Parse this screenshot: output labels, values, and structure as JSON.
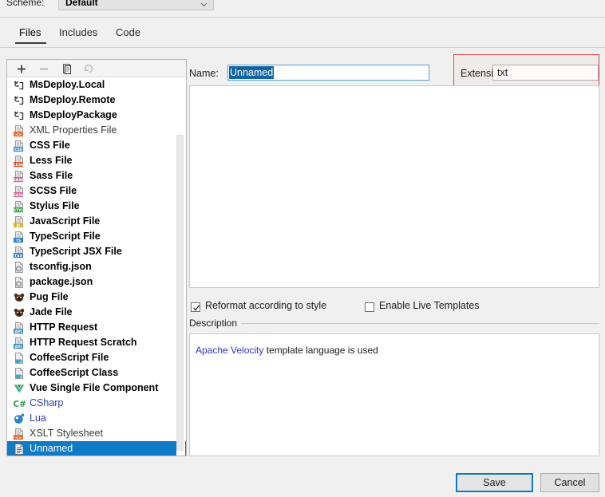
{
  "scheme": {
    "label": "Scheme:",
    "value": "Default",
    "chevron_icon": "chevron-down-icon"
  },
  "tabs": [
    {
      "label": "Files",
      "active": true
    },
    {
      "label": "Includes",
      "active": false
    },
    {
      "label": "Code",
      "active": false
    }
  ],
  "list_toolbar": [
    {
      "name": "add-button",
      "icon": "plus-icon",
      "enabled": true
    },
    {
      "name": "remove-button",
      "icon": "minus-icon",
      "enabled": false
    },
    {
      "name": "copy-button",
      "icon": "copy-icon",
      "enabled": true
    },
    {
      "name": "revert-button",
      "icon": "undo-arrow-icon",
      "enabled": false
    }
  ],
  "file_list": [
    {
      "label": "MsDeploy.Local",
      "icon": "msdeploy-icon",
      "style": "bold"
    },
    {
      "label": "MsDeploy.Remote",
      "icon": "msdeploy-icon",
      "style": "bold"
    },
    {
      "label": "MsDeployPackage",
      "icon": "msdeploy-icon",
      "style": "bold"
    },
    {
      "label": "XML Properties File",
      "icon": "xml-file-icon",
      "style": "norm"
    },
    {
      "label": "CSS File",
      "icon": "css-file-icon",
      "style": "bold"
    },
    {
      "label": "Less File",
      "icon": "less-file-icon",
      "style": "bold"
    },
    {
      "label": "Sass File",
      "icon": "sass-file-icon",
      "style": "bold"
    },
    {
      "label": "SCSS File",
      "icon": "scss-file-icon",
      "style": "bold"
    },
    {
      "label": "Stylus File",
      "icon": "stylus-file-icon",
      "style": "bold"
    },
    {
      "label": "JavaScript File",
      "icon": "javascript-file-icon",
      "style": "bold"
    },
    {
      "label": "TypeScript File",
      "icon": "typescript-file-icon",
      "style": "bold"
    },
    {
      "label": "TypeScript JSX File",
      "icon": "typescript-jsx-file-icon",
      "style": "bold"
    },
    {
      "label": "tsconfig.json",
      "icon": "json-config-icon",
      "style": "bold"
    },
    {
      "label": "package.json",
      "icon": "json-config-icon",
      "style": "bold"
    },
    {
      "label": "Pug File",
      "icon": "pug-file-icon",
      "style": "bold"
    },
    {
      "label": "Jade File",
      "icon": "pug-file-icon",
      "style": "bold"
    },
    {
      "label": "HTTP Request",
      "icon": "http-request-icon",
      "style": "bold"
    },
    {
      "label": "HTTP Request Scratch",
      "icon": "http-request-icon",
      "style": "bold"
    },
    {
      "label": "CoffeeScript File",
      "icon": "coffeescript-file-icon",
      "style": "bold"
    },
    {
      "label": "CoffeeScript Class",
      "icon": "coffeescript-file-icon",
      "style": "bold"
    },
    {
      "label": "Vue Single File Component",
      "icon": "vue-file-icon",
      "style": "bold"
    },
    {
      "label": "CSharp",
      "icon": "csharp-file-icon",
      "style": "blue"
    },
    {
      "label": "Lua",
      "icon": "lua-file-icon",
      "style": "blue"
    },
    {
      "label": "XSLT Stylesheet",
      "icon": "xslt-file-icon",
      "style": "norm"
    },
    {
      "label": "Unnamed",
      "icon": "text-file-icon",
      "style": "bold",
      "selected": true
    }
  ],
  "name_field": {
    "label": "Name:",
    "value": "Unnamed",
    "selected": true
  },
  "extension_field": {
    "label": "Extension:",
    "value": "txt"
  },
  "editor": {
    "content": ""
  },
  "options": {
    "reformat": {
      "label": "Reformat according to style",
      "checked": true
    },
    "live_templates": {
      "label": "Enable Live Templates",
      "checked": false
    }
  },
  "description": {
    "legend": "Description",
    "link_text": "Apache Velocity",
    "rest_text": " template language is used"
  },
  "buttons": {
    "save": "Save",
    "cancel": "Cancel"
  },
  "colors": {
    "accent": "#0f7ac6",
    "selection": "#1264a3",
    "highlight_red": "#e04848",
    "link": "#3333cc"
  }
}
